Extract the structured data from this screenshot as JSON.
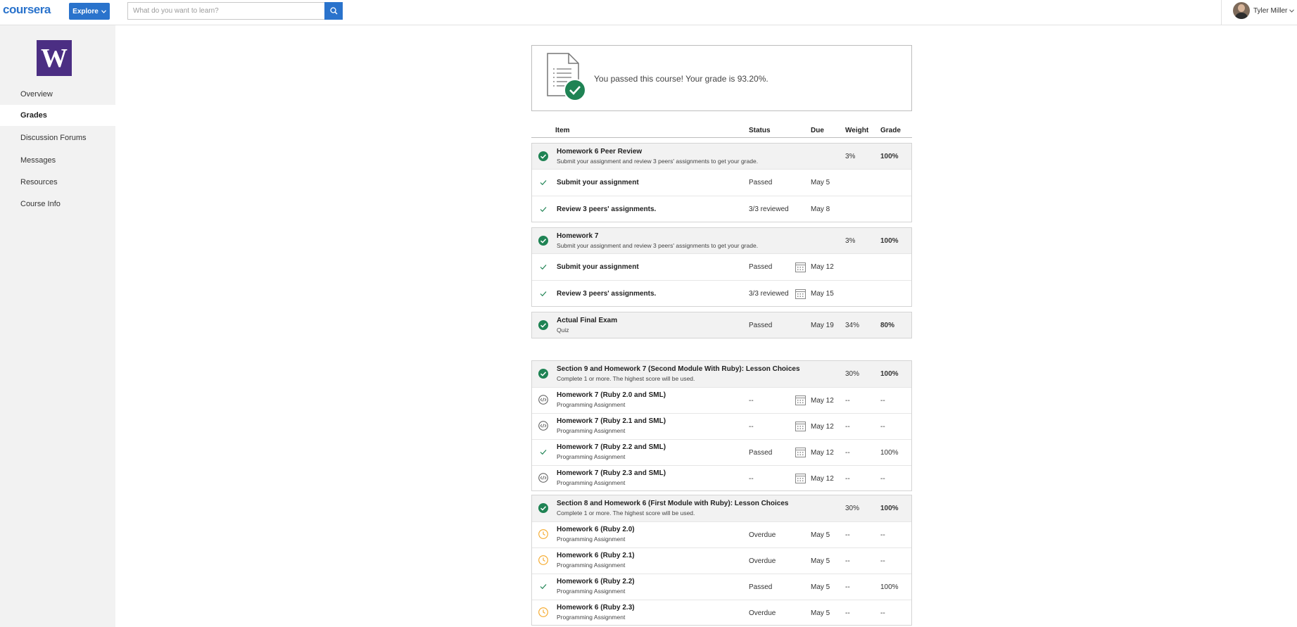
{
  "topbar": {
    "logo": "coursera",
    "explore_label": "Explore",
    "search_placeholder": "What do you want to learn?",
    "user_name": "Tyler Miller"
  },
  "sidebar": {
    "logo_letter": "W",
    "items": [
      {
        "label": "Overview"
      },
      {
        "label": "Grades"
      },
      {
        "label": "Discussion Forums"
      },
      {
        "label": "Messages"
      },
      {
        "label": "Resources"
      },
      {
        "label": "Course Info"
      }
    ],
    "active_index": 1
  },
  "pass_message": "You passed this course! Your grade is 93.20%.",
  "columns": {
    "item": "Item",
    "status": "Status",
    "due": "Due",
    "weight": "Weight",
    "grade": "Grade"
  },
  "groups": [
    {
      "header": {
        "title": "Homework 6 Peer Review",
        "subtitle": "Submit your assignment and review 3 peers' assignments to get your grade.",
        "weight": "3%",
        "grade": "100%"
      },
      "rows": [
        {
          "title": "Submit your assignment",
          "status": "Passed",
          "due": "May 5"
        },
        {
          "title": "Review 3 peers' assignments.",
          "status": "3/3 reviewed",
          "due": "May 8"
        }
      ]
    },
    {
      "header": {
        "title": "Homework 7",
        "subtitle": "Submit your assignment and review 3 peers' assignments to get your grade.",
        "weight": "3%",
        "grade": "100%"
      },
      "rows": [
        {
          "title": "Submit your assignment",
          "status": "Passed",
          "due": "May 12"
        },
        {
          "title": "Review 3 peers' assignments.",
          "status": "3/3 reviewed",
          "due": "May 15"
        }
      ]
    },
    {
      "header": {
        "title": "Actual Final Exam",
        "subtitle": "Quiz",
        "status": "Passed",
        "due": "May 19",
        "weight": "34%",
        "grade": "80%"
      }
    },
    {
      "header": {
        "title": "Section 9 and Homework 7 (Second Module With Ruby): Lesson Choices",
        "subtitle": "Complete 1 or more. The highest score will be used.",
        "weight": "30%",
        "grade": "100%"
      },
      "rows": [
        {
          "title": "Homework 7 (Ruby 2.0 and SML)",
          "subtitle": "Programming Assignment",
          "status": "--",
          "due": "May 12",
          "weight": "--",
          "grade": "--"
        },
        {
          "title": "Homework 7 (Ruby 2.1 and SML)",
          "subtitle": "Programming Assignment",
          "status": "--",
          "due": "May 12",
          "weight": "--",
          "grade": "--"
        },
        {
          "title": "Homework 7 (Ruby 2.2 and SML)",
          "subtitle": "Programming Assignment",
          "status": "Passed",
          "due": "May 12",
          "weight": "--",
          "grade": "100%"
        },
        {
          "title": "Homework 7 (Ruby 2.3 and SML)",
          "subtitle": "Programming Assignment",
          "status": "--",
          "due": "May 12",
          "weight": "--",
          "grade": "--"
        }
      ]
    },
    {
      "header": {
        "title": "Section 8 and Homework 6 (First Module with Ruby): Lesson Choices",
        "subtitle": "Complete 1 or more. The highest score will be used.",
        "weight": "30%",
        "grade": "100%"
      },
      "rows": [
        {
          "title": "Homework 6 (Ruby 2.0)",
          "subtitle": "Programming Assignment",
          "status": "Overdue",
          "due": "May 5",
          "weight": "--",
          "grade": "--"
        },
        {
          "title": "Homework 6 (Ruby 2.1)",
          "subtitle": "Programming Assignment",
          "status": "Overdue",
          "due": "May 5",
          "weight": "--",
          "grade": "--"
        },
        {
          "title": "Homework 6 (Ruby 2.2)",
          "subtitle": "Programming Assignment",
          "status": "Passed",
          "due": "May 5",
          "weight": "--",
          "grade": "100%"
        },
        {
          "title": "Homework 6 (Ruby 2.3)",
          "subtitle": "Programming Assignment",
          "status": "Overdue",
          "due": "May 5",
          "weight": "--",
          "grade": "--"
        }
      ]
    }
  ],
  "colors": {
    "brand": "#2a73cc",
    "pass_green": "#1f8354",
    "overdue_orange": "#f5a623",
    "uw_purple": "#4b2e83"
  }
}
